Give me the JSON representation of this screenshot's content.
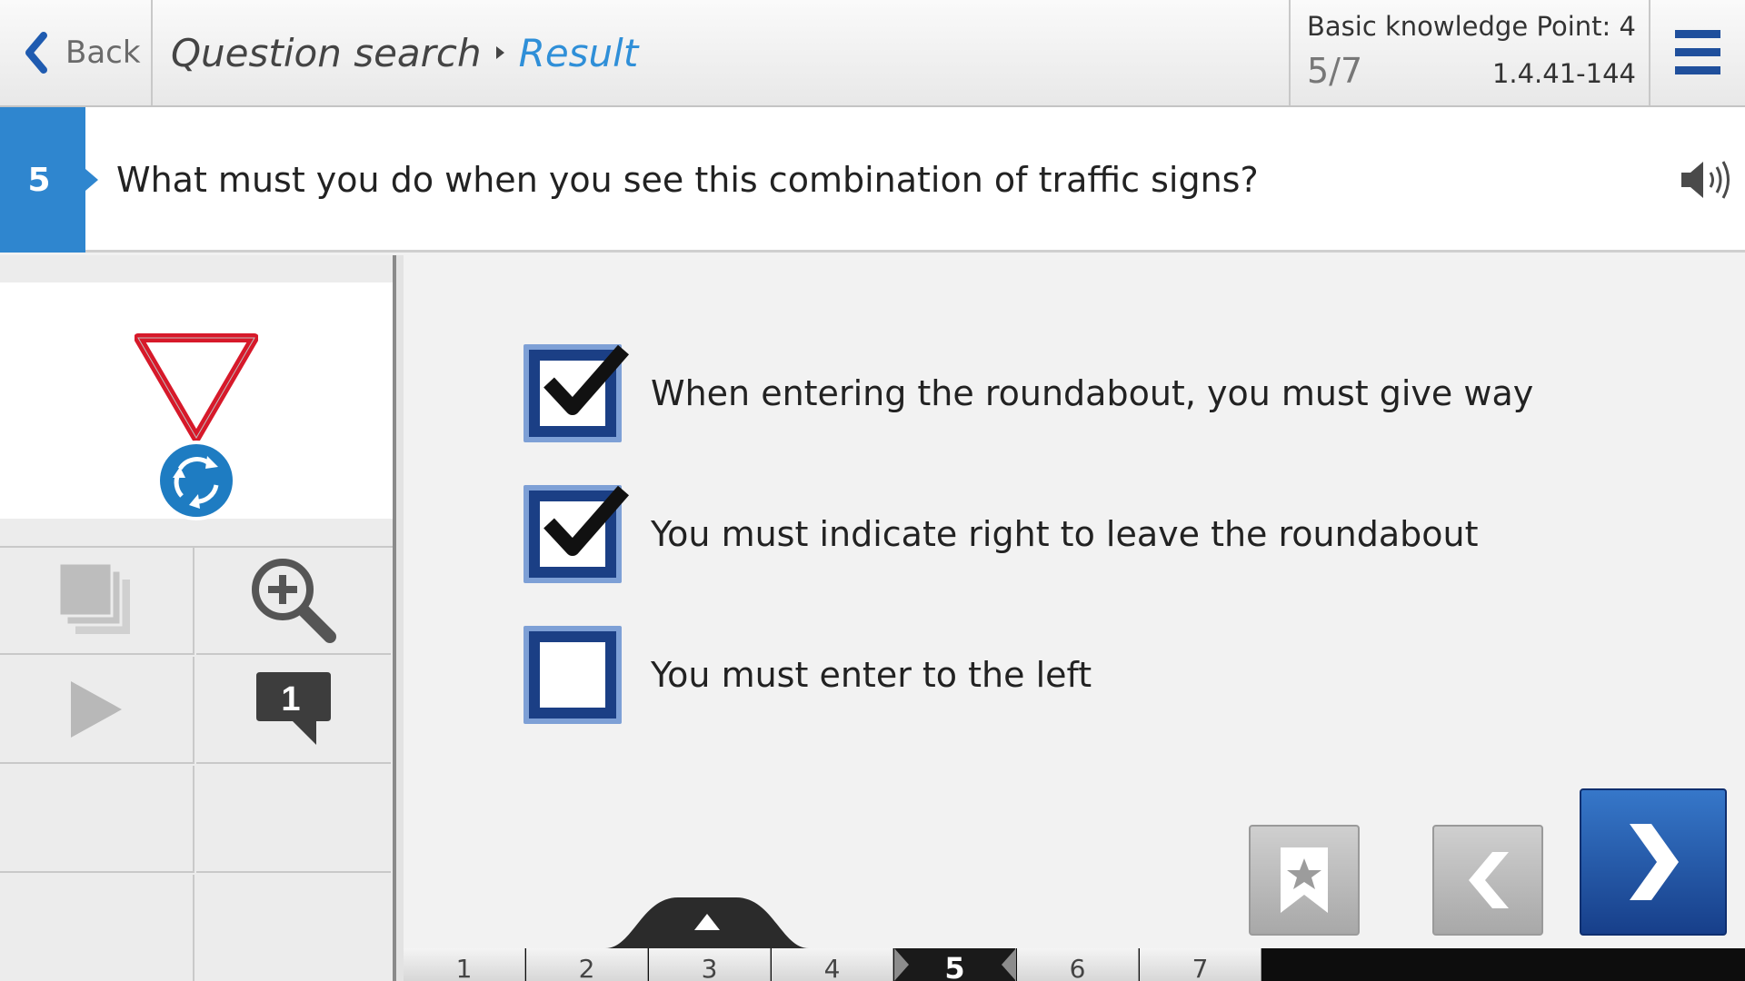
{
  "header": {
    "back_label": "Back",
    "breadcrumb": [
      "Question search",
      "Result"
    ],
    "category": "Basic knowledge",
    "points": "Point: 4",
    "progress": "5/7",
    "question_id": "1.4.41-144"
  },
  "question": {
    "number": "5",
    "text": "What must you do when you see this combination of traffic signs?"
  },
  "image": {
    "signs": [
      "yield-sign-icon",
      "roundabout-sign-icon"
    ]
  },
  "tools": {
    "icons": [
      "image-gallery-icon",
      "zoom-in-icon",
      "play-icon",
      "comment-icon"
    ],
    "comment_count": "1"
  },
  "answers": [
    {
      "text": "When entering the roundabout, you must give way",
      "checked": true
    },
    {
      "text": "You must indicate right to leave the roundabout",
      "checked": true
    },
    {
      "text": "You must enter to the left",
      "checked": false
    }
  ],
  "pager": {
    "pages": [
      "1",
      "2",
      "3",
      "4",
      "5",
      "6",
      "7"
    ],
    "current": "5"
  },
  "colors": {
    "accent": "#2f86cf",
    "checkbox": "#1b3f85",
    "next_button": "#245ba8"
  }
}
